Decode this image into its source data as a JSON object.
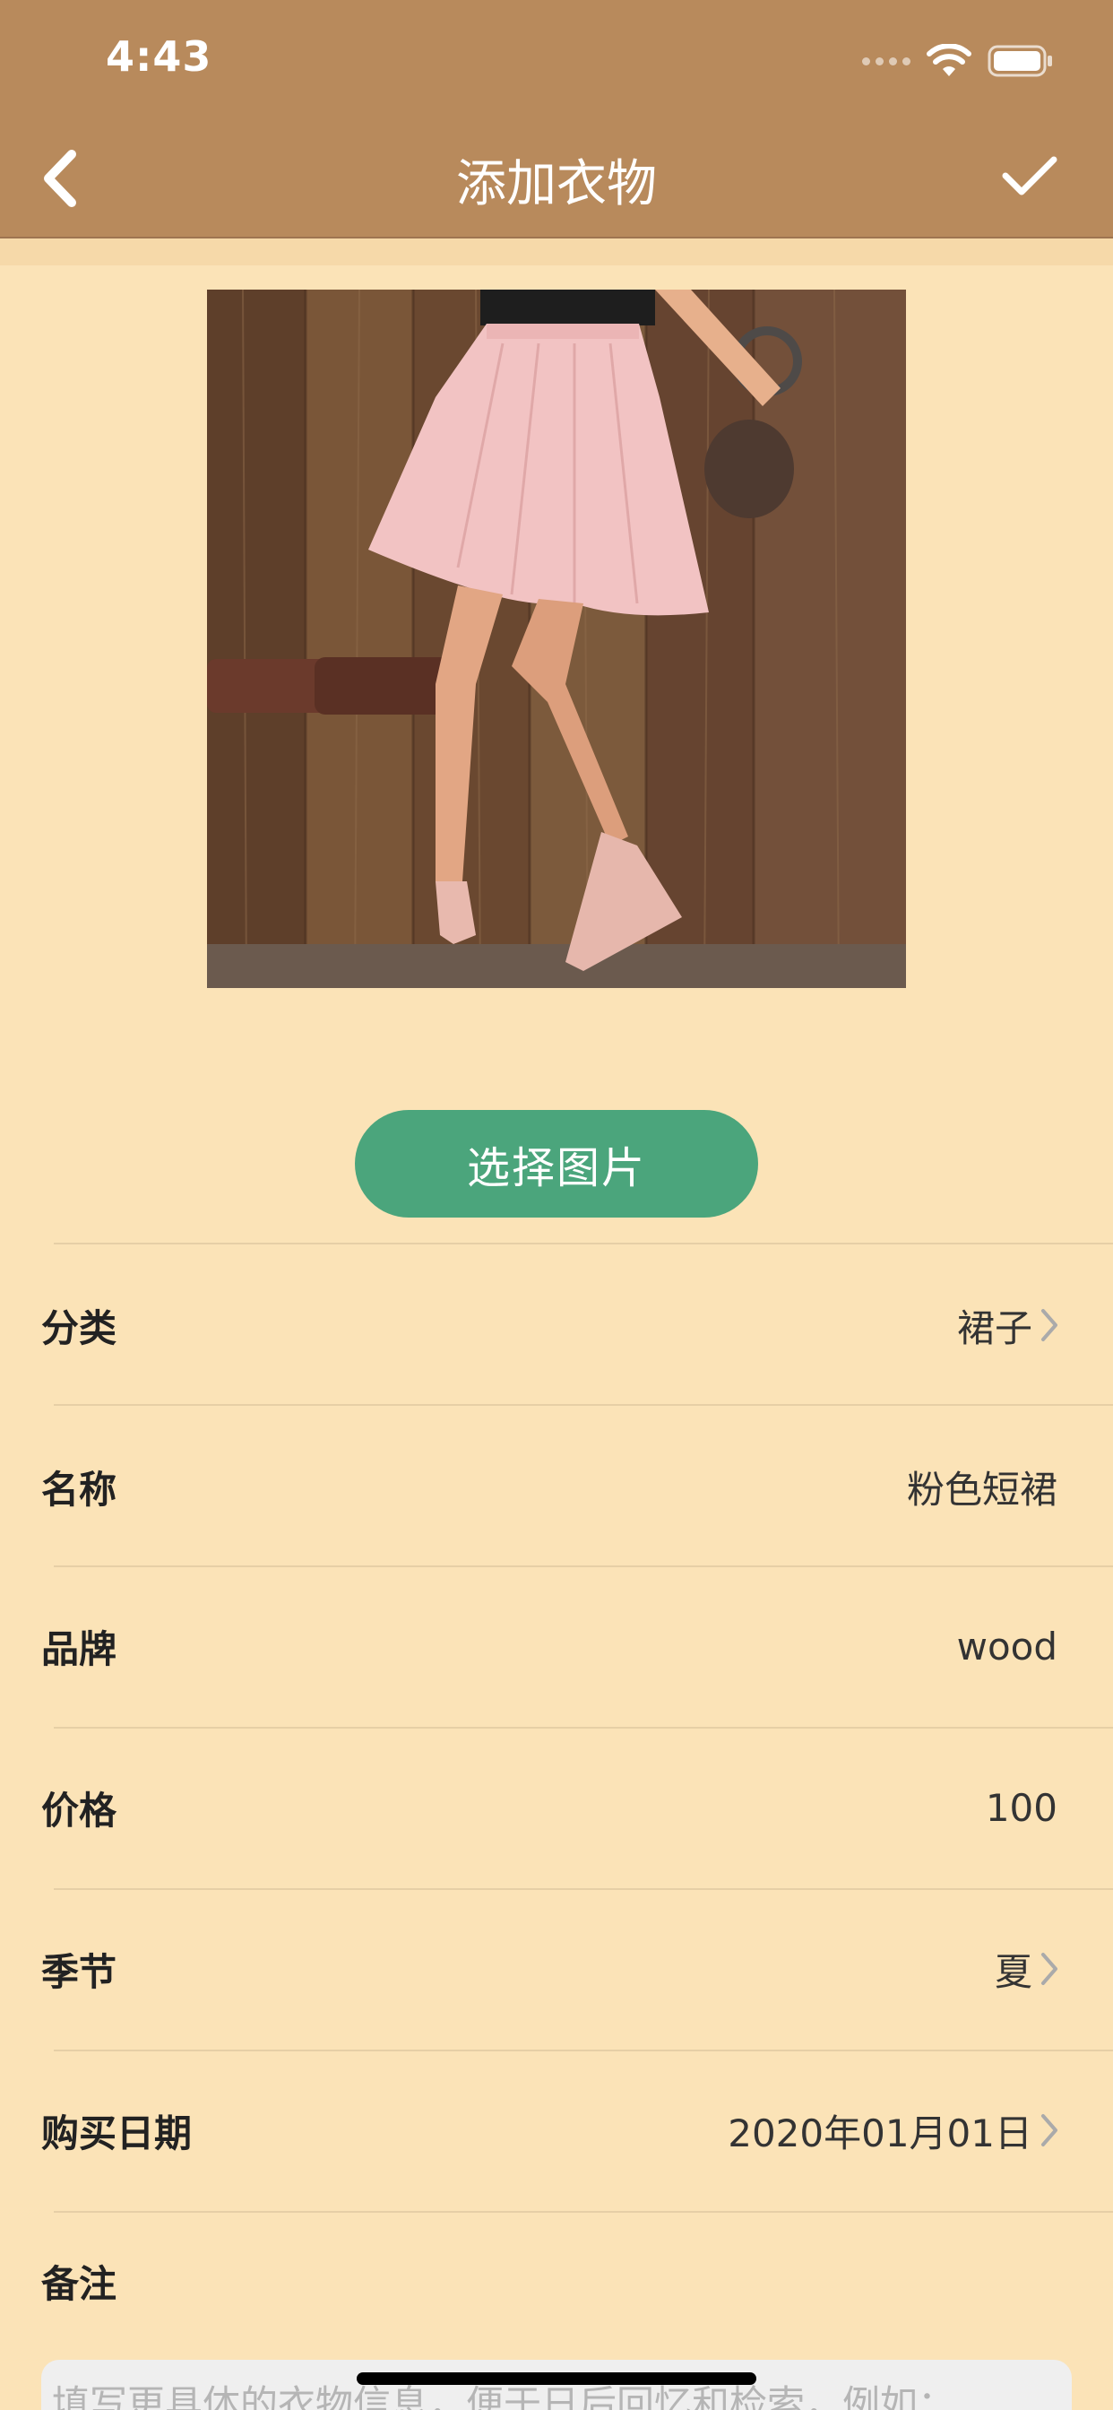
{
  "status_bar": {
    "time": "4:43"
  },
  "nav": {
    "title": "添加衣物"
  },
  "photo": {
    "description_icon": "skirt-photo"
  },
  "select_button": {
    "label": "选择图片"
  },
  "fields": [
    {
      "label": "分类",
      "value": "裙子",
      "chevron": true
    },
    {
      "label": "名称",
      "value": "粉色短裙",
      "chevron": false
    },
    {
      "label": "品牌",
      "value": "wood",
      "chevron": false
    },
    {
      "label": "价格",
      "value": "100",
      "chevron": false
    },
    {
      "label": "季节",
      "value": "夏",
      "chevron": true
    },
    {
      "label": "购买日期",
      "value": "2020年01月01日",
      "chevron": true
    }
  ],
  "note": {
    "label": "备注",
    "placeholder": "填写更具体的衣物信息，便于日后回忆和检索，例如："
  },
  "colors": {
    "header": "#B88A5C",
    "background": "#FBE3B7",
    "accent_button": "#4BA57C"
  }
}
